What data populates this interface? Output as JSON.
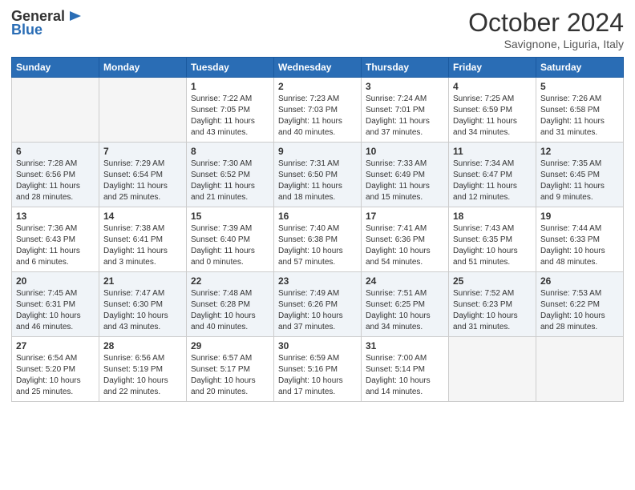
{
  "header": {
    "logo_general": "General",
    "logo_blue": "Blue",
    "month_title": "October 2024",
    "subtitle": "Savignone, Liguria, Italy"
  },
  "days_of_week": [
    "Sunday",
    "Monday",
    "Tuesday",
    "Wednesday",
    "Thursday",
    "Friday",
    "Saturday"
  ],
  "weeks": [
    [
      {
        "day": "",
        "sunrise": "",
        "sunset": "",
        "daylight": "",
        "empty": true
      },
      {
        "day": "",
        "sunrise": "",
        "sunset": "",
        "daylight": "",
        "empty": true
      },
      {
        "day": "1",
        "sunrise": "Sunrise: 7:22 AM",
        "sunset": "Sunset: 7:05 PM",
        "daylight": "Daylight: 11 hours and 43 minutes.",
        "empty": false
      },
      {
        "day": "2",
        "sunrise": "Sunrise: 7:23 AM",
        "sunset": "Sunset: 7:03 PM",
        "daylight": "Daylight: 11 hours and 40 minutes.",
        "empty": false
      },
      {
        "day": "3",
        "sunrise": "Sunrise: 7:24 AM",
        "sunset": "Sunset: 7:01 PM",
        "daylight": "Daylight: 11 hours and 37 minutes.",
        "empty": false
      },
      {
        "day": "4",
        "sunrise": "Sunrise: 7:25 AM",
        "sunset": "Sunset: 6:59 PM",
        "daylight": "Daylight: 11 hours and 34 minutes.",
        "empty": false
      },
      {
        "day": "5",
        "sunrise": "Sunrise: 7:26 AM",
        "sunset": "Sunset: 6:58 PM",
        "daylight": "Daylight: 11 hours and 31 minutes.",
        "empty": false
      }
    ],
    [
      {
        "day": "6",
        "sunrise": "Sunrise: 7:28 AM",
        "sunset": "Sunset: 6:56 PM",
        "daylight": "Daylight: 11 hours and 28 minutes.",
        "empty": false
      },
      {
        "day": "7",
        "sunrise": "Sunrise: 7:29 AM",
        "sunset": "Sunset: 6:54 PM",
        "daylight": "Daylight: 11 hours and 25 minutes.",
        "empty": false
      },
      {
        "day": "8",
        "sunrise": "Sunrise: 7:30 AM",
        "sunset": "Sunset: 6:52 PM",
        "daylight": "Daylight: 11 hours and 21 minutes.",
        "empty": false
      },
      {
        "day": "9",
        "sunrise": "Sunrise: 7:31 AM",
        "sunset": "Sunset: 6:50 PM",
        "daylight": "Daylight: 11 hours and 18 minutes.",
        "empty": false
      },
      {
        "day": "10",
        "sunrise": "Sunrise: 7:33 AM",
        "sunset": "Sunset: 6:49 PM",
        "daylight": "Daylight: 11 hours and 15 minutes.",
        "empty": false
      },
      {
        "day": "11",
        "sunrise": "Sunrise: 7:34 AM",
        "sunset": "Sunset: 6:47 PM",
        "daylight": "Daylight: 11 hours and 12 minutes.",
        "empty": false
      },
      {
        "day": "12",
        "sunrise": "Sunrise: 7:35 AM",
        "sunset": "Sunset: 6:45 PM",
        "daylight": "Daylight: 11 hours and 9 minutes.",
        "empty": false
      }
    ],
    [
      {
        "day": "13",
        "sunrise": "Sunrise: 7:36 AM",
        "sunset": "Sunset: 6:43 PM",
        "daylight": "Daylight: 11 hours and 6 minutes.",
        "empty": false
      },
      {
        "day": "14",
        "sunrise": "Sunrise: 7:38 AM",
        "sunset": "Sunset: 6:41 PM",
        "daylight": "Daylight: 11 hours and 3 minutes.",
        "empty": false
      },
      {
        "day": "15",
        "sunrise": "Sunrise: 7:39 AM",
        "sunset": "Sunset: 6:40 PM",
        "daylight": "Daylight: 11 hours and 0 minutes.",
        "empty": false
      },
      {
        "day": "16",
        "sunrise": "Sunrise: 7:40 AM",
        "sunset": "Sunset: 6:38 PM",
        "daylight": "Daylight: 10 hours and 57 minutes.",
        "empty": false
      },
      {
        "day": "17",
        "sunrise": "Sunrise: 7:41 AM",
        "sunset": "Sunset: 6:36 PM",
        "daylight": "Daylight: 10 hours and 54 minutes.",
        "empty": false
      },
      {
        "day": "18",
        "sunrise": "Sunrise: 7:43 AM",
        "sunset": "Sunset: 6:35 PM",
        "daylight": "Daylight: 10 hours and 51 minutes.",
        "empty": false
      },
      {
        "day": "19",
        "sunrise": "Sunrise: 7:44 AM",
        "sunset": "Sunset: 6:33 PM",
        "daylight": "Daylight: 10 hours and 48 minutes.",
        "empty": false
      }
    ],
    [
      {
        "day": "20",
        "sunrise": "Sunrise: 7:45 AM",
        "sunset": "Sunset: 6:31 PM",
        "daylight": "Daylight: 10 hours and 46 minutes.",
        "empty": false
      },
      {
        "day": "21",
        "sunrise": "Sunrise: 7:47 AM",
        "sunset": "Sunset: 6:30 PM",
        "daylight": "Daylight: 10 hours and 43 minutes.",
        "empty": false
      },
      {
        "day": "22",
        "sunrise": "Sunrise: 7:48 AM",
        "sunset": "Sunset: 6:28 PM",
        "daylight": "Daylight: 10 hours and 40 minutes.",
        "empty": false
      },
      {
        "day": "23",
        "sunrise": "Sunrise: 7:49 AM",
        "sunset": "Sunset: 6:26 PM",
        "daylight": "Daylight: 10 hours and 37 minutes.",
        "empty": false
      },
      {
        "day": "24",
        "sunrise": "Sunrise: 7:51 AM",
        "sunset": "Sunset: 6:25 PM",
        "daylight": "Daylight: 10 hours and 34 minutes.",
        "empty": false
      },
      {
        "day": "25",
        "sunrise": "Sunrise: 7:52 AM",
        "sunset": "Sunset: 6:23 PM",
        "daylight": "Daylight: 10 hours and 31 minutes.",
        "empty": false
      },
      {
        "day": "26",
        "sunrise": "Sunrise: 7:53 AM",
        "sunset": "Sunset: 6:22 PM",
        "daylight": "Daylight: 10 hours and 28 minutes.",
        "empty": false
      }
    ],
    [
      {
        "day": "27",
        "sunrise": "Sunrise: 6:54 AM",
        "sunset": "Sunset: 5:20 PM",
        "daylight": "Daylight: 10 hours and 25 minutes.",
        "empty": false
      },
      {
        "day": "28",
        "sunrise": "Sunrise: 6:56 AM",
        "sunset": "Sunset: 5:19 PM",
        "daylight": "Daylight: 10 hours and 22 minutes.",
        "empty": false
      },
      {
        "day": "29",
        "sunrise": "Sunrise: 6:57 AM",
        "sunset": "Sunset: 5:17 PM",
        "daylight": "Daylight: 10 hours and 20 minutes.",
        "empty": false
      },
      {
        "day": "30",
        "sunrise": "Sunrise: 6:59 AM",
        "sunset": "Sunset: 5:16 PM",
        "daylight": "Daylight: 10 hours and 17 minutes.",
        "empty": false
      },
      {
        "day": "31",
        "sunrise": "Sunrise: 7:00 AM",
        "sunset": "Sunset: 5:14 PM",
        "daylight": "Daylight: 10 hours and 14 minutes.",
        "empty": false
      },
      {
        "day": "",
        "sunrise": "",
        "sunset": "",
        "daylight": "",
        "empty": true
      },
      {
        "day": "",
        "sunrise": "",
        "sunset": "",
        "daylight": "",
        "empty": true
      }
    ]
  ]
}
